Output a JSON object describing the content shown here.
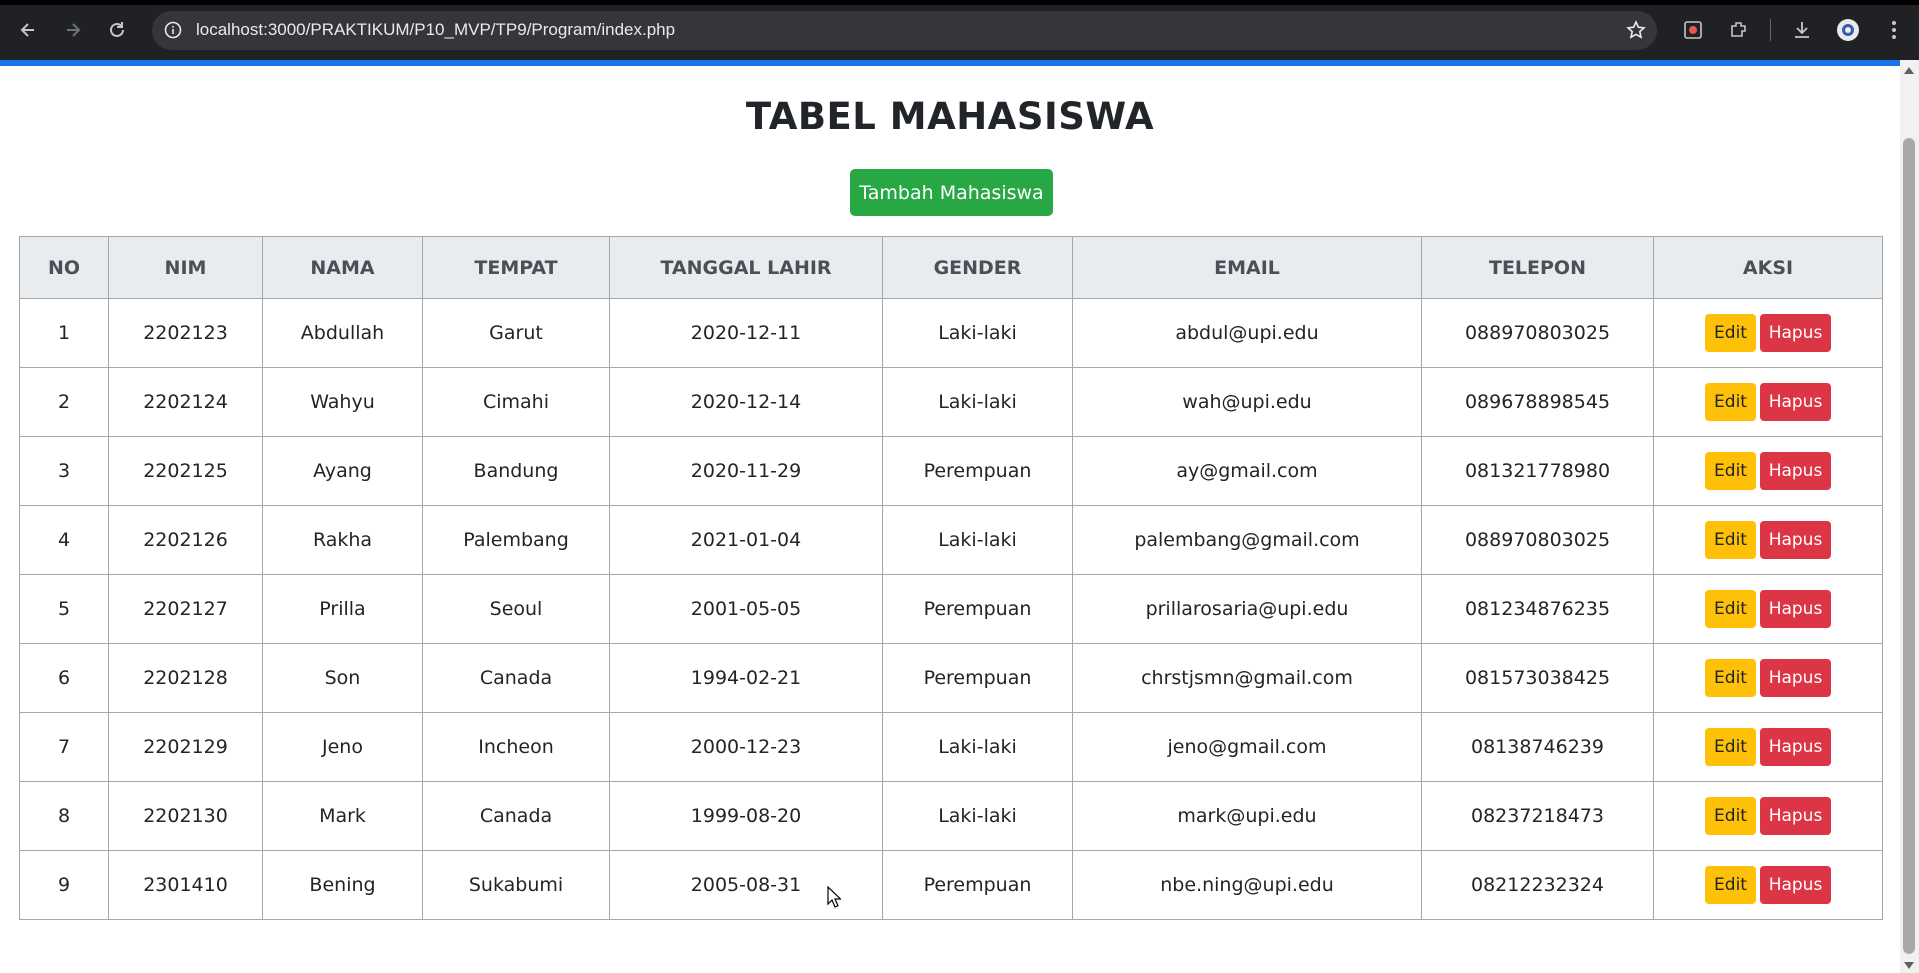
{
  "browser": {
    "url": "localhost:3000/PRAKTIKUM/P10_MVP/TP9/Program/index.php"
  },
  "page": {
    "title": "TABEL MAHASISWA",
    "add_button": "Tambah Mahasiswa"
  },
  "table": {
    "headers": [
      "NO",
      "NIM",
      "NAMA",
      "TEMPAT",
      "TANGGAL LAHIR",
      "GENDER",
      "EMAIL",
      "TELEPON",
      "AKSI"
    ],
    "edit_label": "Edit",
    "delete_label": "Hapus",
    "rows": [
      [
        "1",
        "2202123",
        "Abdullah",
        "Garut",
        "2020-12-11",
        "Laki-laki",
        "abdul@upi.edu",
        "088970803025"
      ],
      [
        "2",
        "2202124",
        "Wahyu",
        "Cimahi",
        "2020-12-14",
        "Laki-laki",
        "wah@upi.edu",
        "089678898545"
      ],
      [
        "3",
        "2202125",
        "Ayang",
        "Bandung",
        "2020-11-29",
        "Perempuan",
        "ay@gmail.com",
        "081321778980"
      ],
      [
        "4",
        "2202126",
        "Rakha",
        "Palembang",
        "2021-01-04",
        "Laki-laki",
        "palembang@gmail.com",
        "088970803025"
      ],
      [
        "5",
        "2202127",
        "Prilla",
        "Seoul",
        "2001-05-05",
        "Perempuan",
        "prillarosaria@upi.edu",
        "081234876235"
      ],
      [
        "6",
        "2202128",
        "Son",
        "Canada",
        "1994-02-21",
        "Perempuan",
        "chrstjsmn@gmail.com",
        "081573038425"
      ],
      [
        "7",
        "2202129",
        "Jeno",
        "Incheon",
        "2000-12-23",
        "Laki-laki",
        "jeno@gmail.com",
        "08138746239"
      ],
      [
        "8",
        "2202130",
        "Mark",
        "Canada",
        "1999-08-20",
        "Laki-laki",
        "mark@upi.edu",
        "08237218473"
      ],
      [
        "9",
        "2301410",
        "Bening",
        "Sukabumi",
        "2005-08-31",
        "Perempuan",
        "nbe.ning@upi.edu",
        "08212232324"
      ]
    ]
  },
  "colors": {
    "add_button": "#28a745",
    "edit_button": "#ffc107",
    "delete_button": "#dc3545",
    "header_bg": "#e9ecef",
    "progress_bar": "#1a73e8"
  }
}
